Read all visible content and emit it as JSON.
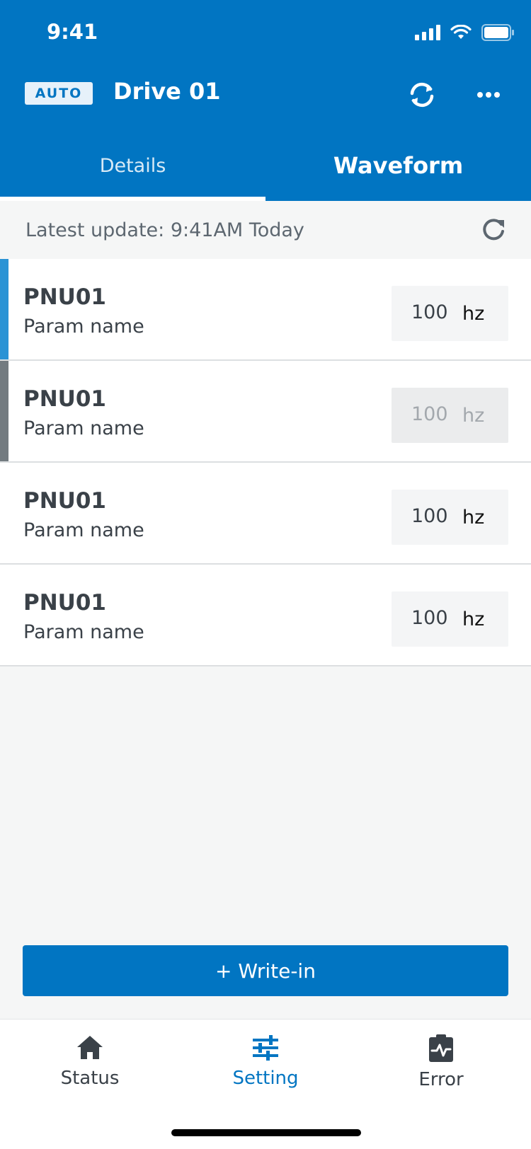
{
  "status_bar": {
    "time": "9:41"
  },
  "header": {
    "mode_badge": "AUTO",
    "title": "Drive 01",
    "sync_icon": "sync-icon",
    "more_icon": "more-icon"
  },
  "tabs": [
    {
      "label": "Details",
      "active": true
    },
    {
      "label": "Waveform",
      "active": false
    }
  ],
  "update": {
    "text": "Latest update: 9:41AM Today",
    "refresh_icon": "refresh-icon"
  },
  "params": [
    {
      "code": "PNU01",
      "name": "Param name",
      "value": "100",
      "unit": "hz",
      "accent": "#2a93d5",
      "disabled": false
    },
    {
      "code": "PNU01",
      "name": "Param name",
      "value": "100",
      "unit": "hz",
      "accent": "#737b80",
      "disabled": true
    },
    {
      "code": "PNU01",
      "name": "Param name",
      "value": "100",
      "unit": "hz",
      "accent": "",
      "disabled": false
    },
    {
      "code": "PNU01",
      "name": "Param name",
      "value": "100",
      "unit": "hz",
      "accent": "",
      "disabled": false
    }
  ],
  "write_button": {
    "label": "+ Write-in"
  },
  "bottom_nav": [
    {
      "label": "Status",
      "icon": "home-icon",
      "active": false
    },
    {
      "label": "Setting",
      "icon": "sliders-icon",
      "active": true
    },
    {
      "label": "Error",
      "icon": "clipboard-pulse-icon",
      "active": false
    }
  ],
  "colors": {
    "primary": "#0175c2",
    "accent_blue": "#2a93d5",
    "accent_gray": "#737b80",
    "text_dark": "#3a4148"
  }
}
